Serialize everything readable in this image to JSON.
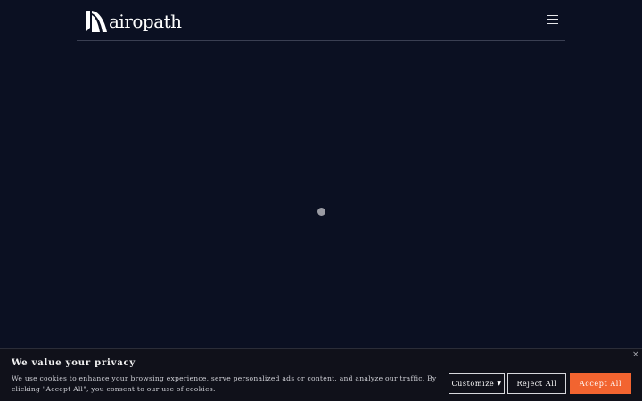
{
  "header": {
    "logo_text": "airopath",
    "menu_icon": "hamburger-menu-icon"
  },
  "loader": {
    "icon": "loading-dot-icon"
  },
  "cookie_banner": {
    "title": "We value your privacy",
    "text": "We use cookies to enhance your browsing experience, serve personalized ads or content, and analyze our traffic. By clicking \"Accept All\", you consent to our use of cookies.",
    "close_label": "×",
    "customize_label": "Customize",
    "customize_caret": "▼",
    "reject_label": "Reject All",
    "accept_label": "Accept All"
  },
  "colors": {
    "background": "#0b1022",
    "accent": "#f26430",
    "banner": "#10111a"
  }
}
